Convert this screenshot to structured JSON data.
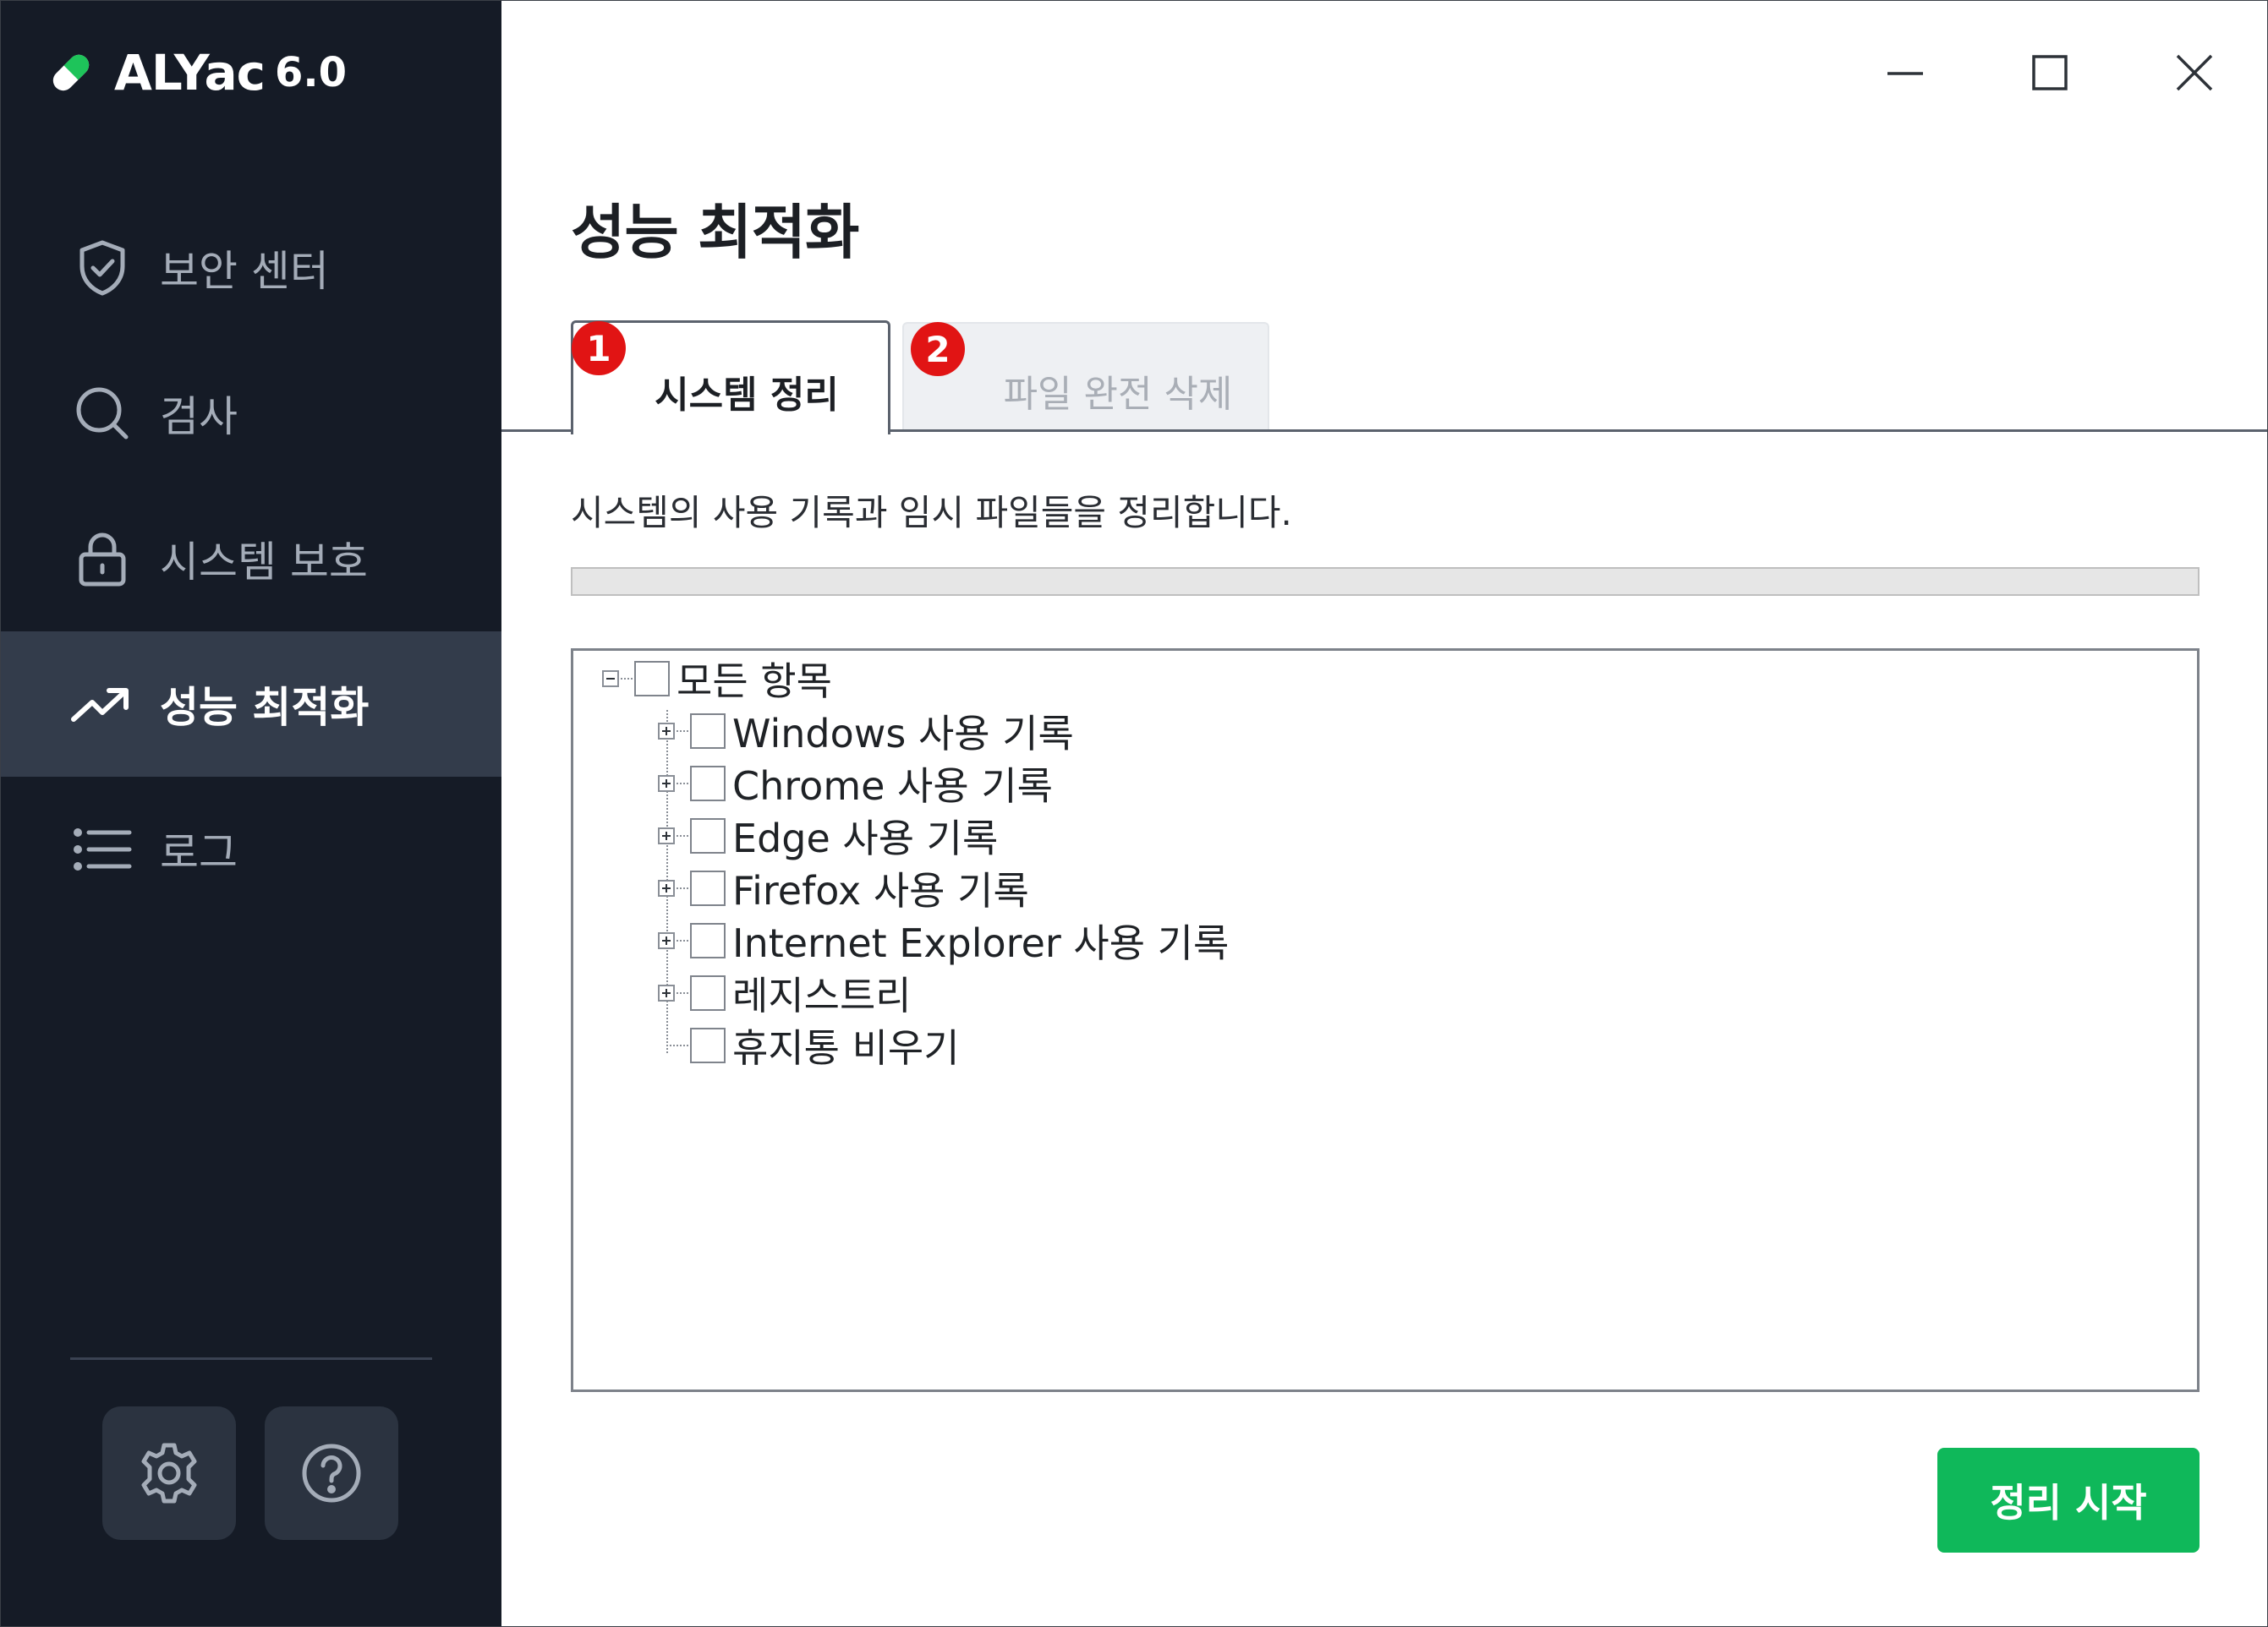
{
  "app": {
    "name": "ALYac",
    "version": "6.0",
    "accent_color": "#0fb85a",
    "sidebar_color": "#151b26"
  },
  "sidebar": {
    "items": [
      {
        "label": "보안 센터",
        "icon": "shield-check-icon",
        "active": false
      },
      {
        "label": "검사",
        "icon": "search-icon",
        "active": false
      },
      {
        "label": "시스템 보호",
        "icon": "lock-icon",
        "active": false
      },
      {
        "label": "성능 최적화",
        "icon": "trending-up-icon",
        "active": true
      },
      {
        "label": "로그",
        "icon": "list-icon",
        "active": false
      }
    ],
    "bottom_buttons": [
      {
        "icon": "gear-icon"
      },
      {
        "icon": "help-icon"
      }
    ]
  },
  "window_controls": {
    "icons": [
      "minimize-icon",
      "maximize-icon",
      "close-icon"
    ]
  },
  "main": {
    "title": "성능 최적화",
    "tabs": [
      {
        "label": "시스템 정리",
        "badge": "1",
        "active": true
      },
      {
        "label": "파일 완전 삭제",
        "badge": "2",
        "active": false
      }
    ],
    "description": "시스템의 사용 기록과 임시 파일들을 정리합니다.",
    "progress": 0,
    "tree": {
      "root": "모든 항목",
      "items": [
        "Windows 사용 기록",
        "Chrome 사용 기록",
        "Edge 사용 기록",
        "Firefox 사용 기록",
        "Internet Explorer 사용 기록",
        "레지스트리",
        "휴지통 비우기"
      ]
    },
    "start_button": "정리 시작"
  }
}
